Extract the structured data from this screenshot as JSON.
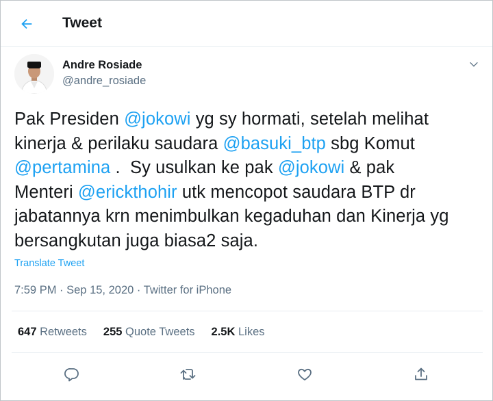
{
  "header": {
    "title": "Tweet",
    "back_icon": "arrow-left-icon"
  },
  "author": {
    "name": "Andre Rosiade",
    "handle": "@andre_rosiade"
  },
  "tweet": {
    "segments": [
      {
        "text": "Pak Presiden ",
        "mention": false
      },
      {
        "text": "@jokowi",
        "mention": true
      },
      {
        "text": " yg sy hormati, setelah melihat\nkinerja & perilaku saudara ",
        "mention": false
      },
      {
        "text": "@basuki_btp",
        "mention": true
      },
      {
        "text": " sbg Komut\n",
        "mention": false
      },
      {
        "text": "@pertamina",
        "mention": true
      },
      {
        "text": " .  Sy usulkan ke pak ",
        "mention": false
      },
      {
        "text": "@jokowi",
        "mention": true
      },
      {
        "text": " & pak\nMenteri ",
        "mention": false
      },
      {
        "text": "@erickthohir",
        "mention": true
      },
      {
        "text": " utk mencopot saudara BTP dr\njabatannya krn menimbulkan kegaduhan dan Kinerja yg\nbersangkutan juga biasa2 saja.",
        "mention": false
      }
    ],
    "translate_label": "Translate Tweet",
    "time": "7:59 PM",
    "date": "Sep 15, 2020",
    "source": "Twitter for iPhone",
    "separator": " · "
  },
  "stats": {
    "retweets": {
      "count": "647",
      "label": " Retweets"
    },
    "quotes": {
      "count": "255",
      "label": " Quote Tweets"
    },
    "likes": {
      "count": "2.5K",
      "label": " Likes"
    }
  },
  "actions": [
    "reply-icon",
    "retweet-icon",
    "like-icon",
    "share-icon"
  ],
  "colors": {
    "accent": "#1da1f2",
    "secondary_text": "#5b7083",
    "text": "#14171a",
    "divider": "#e6ecf0"
  }
}
